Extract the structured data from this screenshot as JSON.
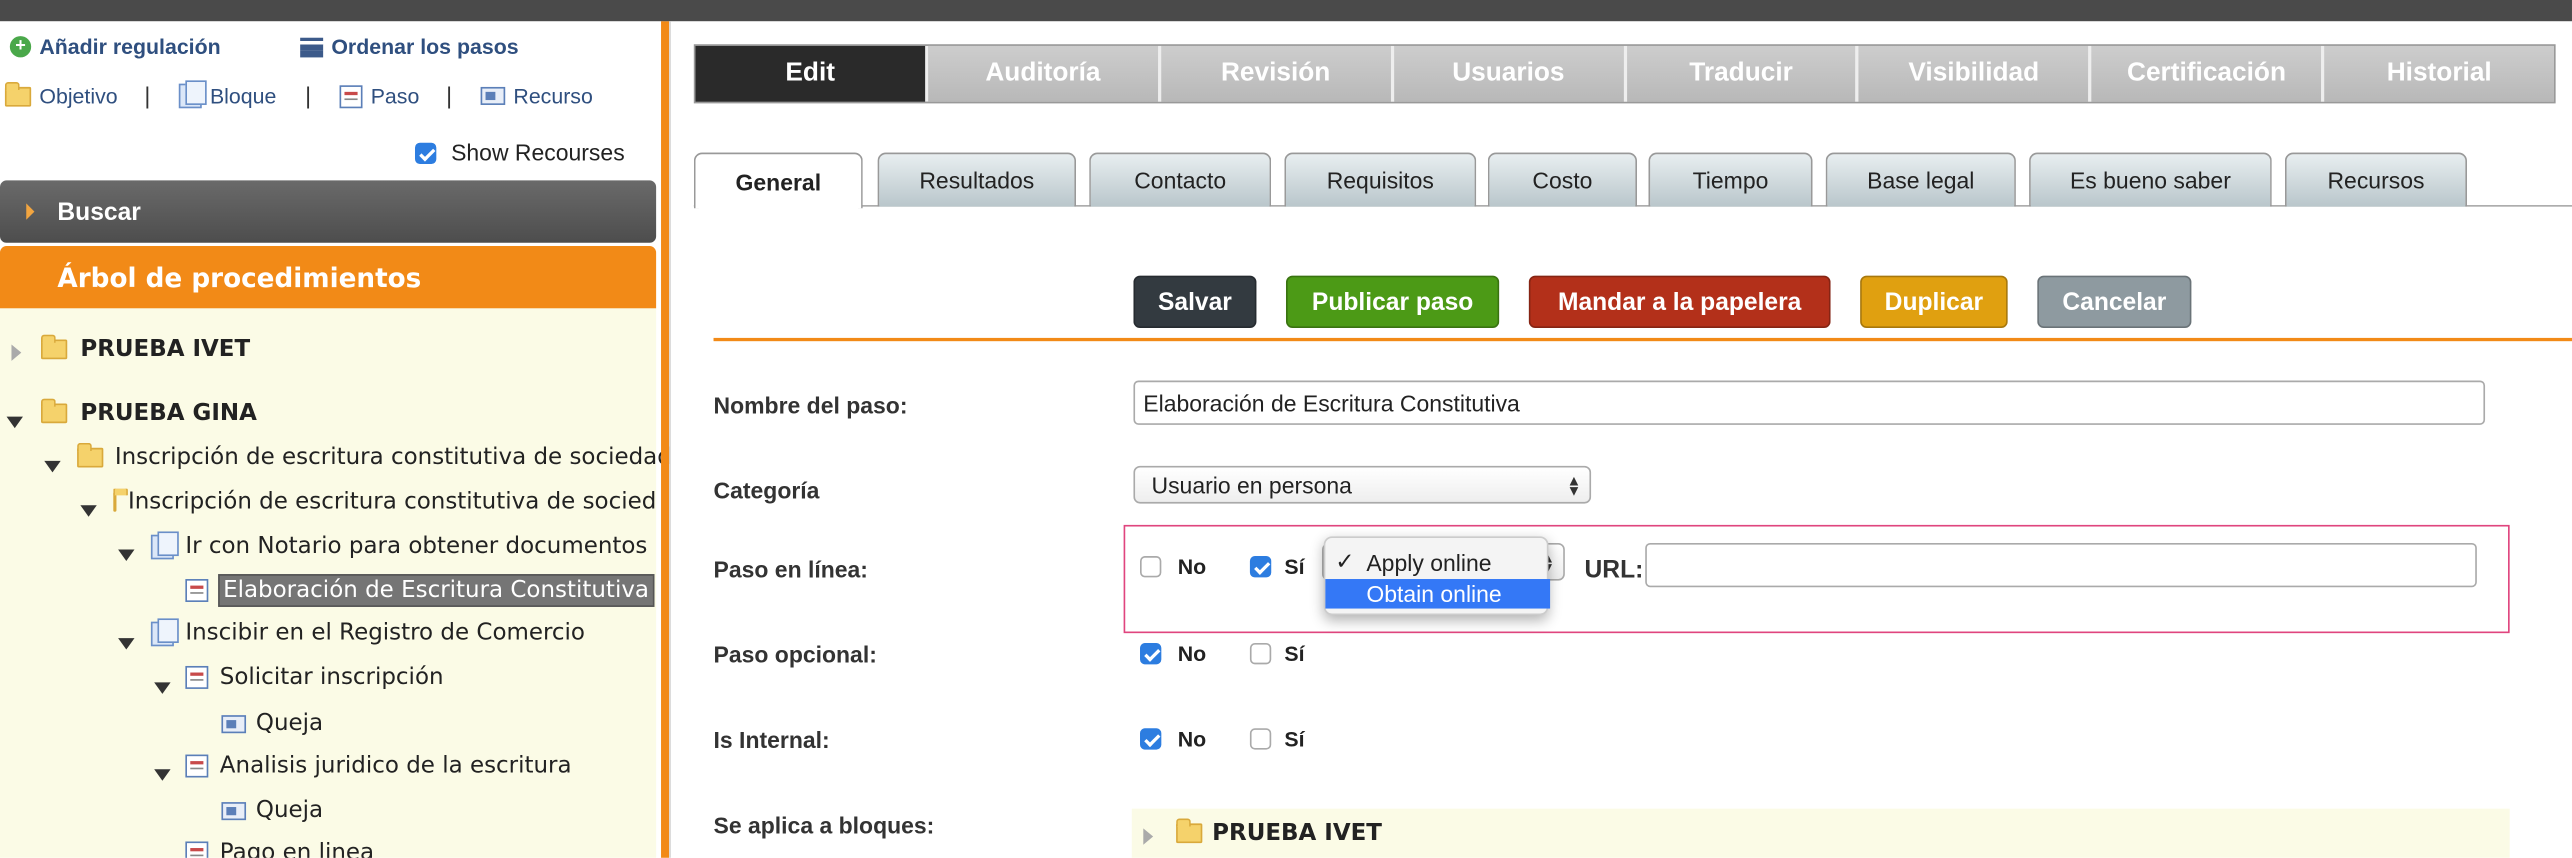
{
  "left": {
    "toolbar": {
      "add_regulation": "Añadir regulación",
      "order_steps": "Ordenar los pasos",
      "objetivo": "Objetivo",
      "bloque": "Bloque",
      "paso": "Paso",
      "recurso": "Recurso",
      "separator": "|"
    },
    "show_resources": {
      "label": "Show Recourses",
      "checked": true
    },
    "buscar": "Buscar",
    "arbol_title": "Árbol de procedimientos",
    "tree": [
      "PRUEBA IVET",
      "PRUEBA GINA",
      "Inscripción de escritura constitutiva de sociedad",
      "Inscripción de escritura constitutiva de socieda",
      "Ir con Notario para obtener documentos",
      "Elaboración de Escritura Constitutiva",
      "Inscibir en el Registro de Comercio",
      "Solicitar inscripción",
      "Queja",
      "Analisis juridico de la escritura",
      "Queja",
      "Pago en linea"
    ]
  },
  "top_tabs": [
    "Edit",
    "Auditoría",
    "Revisión",
    "Usuarios",
    "Traducir",
    "Visibilidad",
    "Certificación",
    "Historial"
  ],
  "sub_tabs": [
    "General",
    "Resultados",
    "Contacto",
    "Requisitos",
    "Costo",
    "Tiempo",
    "Base legal",
    "Es bueno saber",
    "Recursos"
  ],
  "buttons": {
    "save": "Salvar",
    "publish": "Publicar paso",
    "trash": "Mandar a la papelera",
    "duplicate": "Duplicar",
    "cancel": "Cancelar"
  },
  "form": {
    "step_name_label": "Nombre del paso:",
    "step_name_value": "Elaboración de Escritura Constitutiva",
    "category_label": "Categoría",
    "category_value": "Usuario en persona",
    "online_label": "Paso en línea:",
    "no": "No",
    "si": "Sí",
    "url_label": "URL:",
    "url_value": "",
    "online_dropdown": {
      "checkmark": "✓",
      "options": [
        "Apply online",
        "Obtain online"
      ],
      "checked": "Apply online",
      "highlighted": "Obtain online"
    },
    "optional_label": "Paso opcional:",
    "internal_label": "Is Internal:",
    "blocks_label": "Se aplica a bloques:",
    "blocks_item": "PRUEBA IVET"
  },
  "colors": {
    "accent_orange": "#f28a17",
    "save": "#333a40",
    "publish": "#4c9a16",
    "trash": "#b3301a",
    "duplicate": "#e0a010",
    "cancel": "#8e9aa0",
    "highlight": "#e0457e"
  }
}
